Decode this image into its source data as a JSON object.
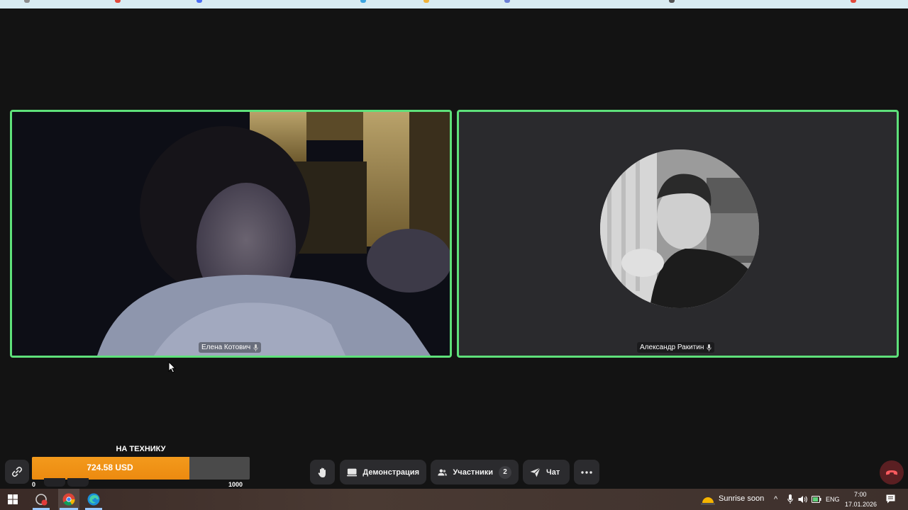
{
  "participants": [
    {
      "name": "Елена Котович"
    },
    {
      "name": "Александр Ракитин"
    }
  ],
  "donation": {
    "title": "НА ТЕХНИКУ",
    "amount": "724.58 USD",
    "min": "0",
    "max": "1000",
    "progress": 0.72458
  },
  "controls": {
    "link_icon": "link-icon",
    "raise_hand_icon": "raise-hand-icon",
    "screen_share_label": "Демонстрация",
    "participants_label": "Участники",
    "participants_count": "2",
    "chat_label": "Чат",
    "more_icon": "more-icon",
    "hangup_icon": "hangup-icon"
  },
  "taskbar": {
    "weather": "Sunrise soon",
    "language": "ENG",
    "time": "7:00",
    "date": "17.01.2026"
  },
  "colors": {
    "active_speaker_border": "#5ee07a",
    "donation_fill": "#f39a1c",
    "hangup": "#e0404a",
    "background": "#131313"
  }
}
